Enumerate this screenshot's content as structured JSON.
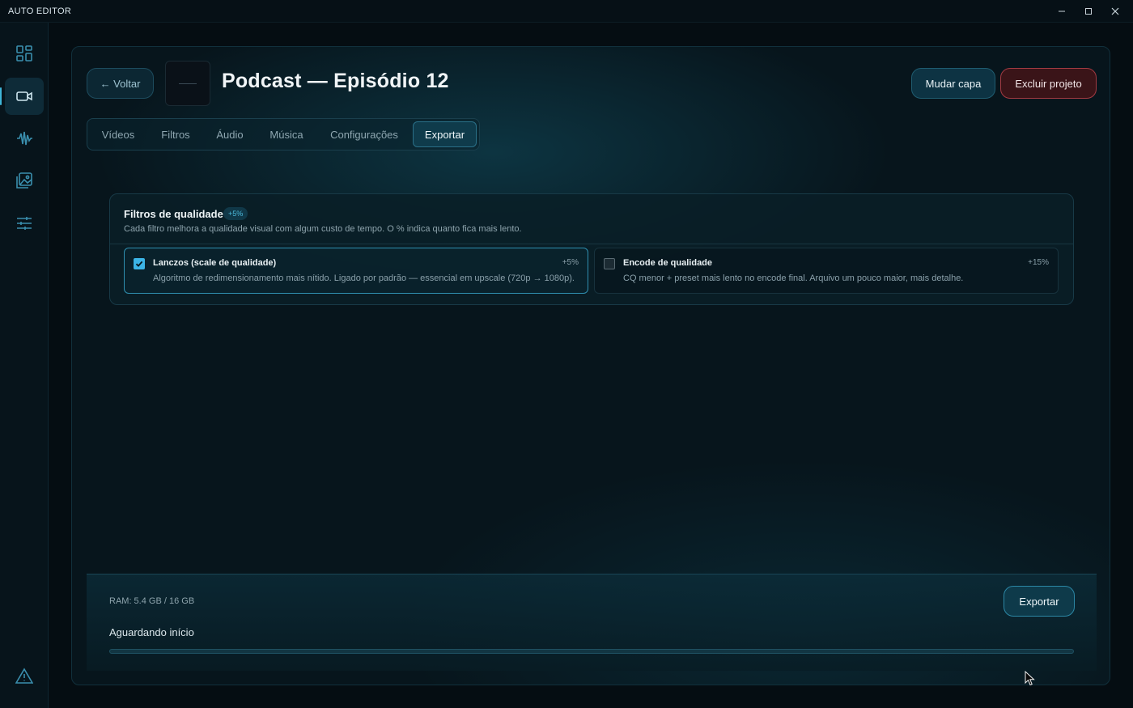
{
  "window": {
    "title": "AUTO EDITOR"
  },
  "sidebar": {
    "items": [
      {
        "name": "dashboard",
        "icon": "grid-icon"
      },
      {
        "name": "video",
        "icon": "video-camera-icon",
        "active": true
      },
      {
        "name": "audio",
        "icon": "waveform-icon"
      },
      {
        "name": "images",
        "icon": "image-gallery-icon"
      },
      {
        "name": "settings",
        "icon": "sliders-icon"
      }
    ],
    "bottom_icon": "warning-icon"
  },
  "header": {
    "back_label": "← Voltar",
    "project_title": "Podcast — Episódio 12",
    "change_cover_label": "Mudar capa",
    "delete_label": "Excluir projeto"
  },
  "tabs": [
    {
      "label": "Vídeos",
      "active": false
    },
    {
      "label": "Filtros",
      "active": false
    },
    {
      "label": "Áudio",
      "active": false
    },
    {
      "label": "Música",
      "active": false
    },
    {
      "label": "Configurações",
      "active": false
    },
    {
      "label": "Exportar",
      "active": true
    }
  ],
  "quality": {
    "title": "Filtros de qualidade",
    "badge": "+5%",
    "subtitle": "Cada filtro melhora a qualidade visual com algum custo de tempo. O % indica quanto fica mais lento.",
    "options": [
      {
        "title": "Lanczos (scale de qualidade)",
        "description": "Algoritmo de redimensionamento mais nítido. Ligado por padrão — essencial em upscale (720p → 1080p).",
        "cost": "+5%",
        "checked": true
      },
      {
        "title": "Encode de qualidade",
        "description": "CQ menor + preset mais lento no encode final. Arquivo um pouco maior, mais detalhe.",
        "cost": "+15%",
        "checked": false
      }
    ]
  },
  "export": {
    "ram": "RAM: 5.4 GB / 16 GB",
    "status": "Aguardando início",
    "progress": 0,
    "button_label": "Exportar"
  },
  "colors": {
    "accent": "#3cb4e6",
    "danger": "#a23a42",
    "background": "#050d12"
  }
}
